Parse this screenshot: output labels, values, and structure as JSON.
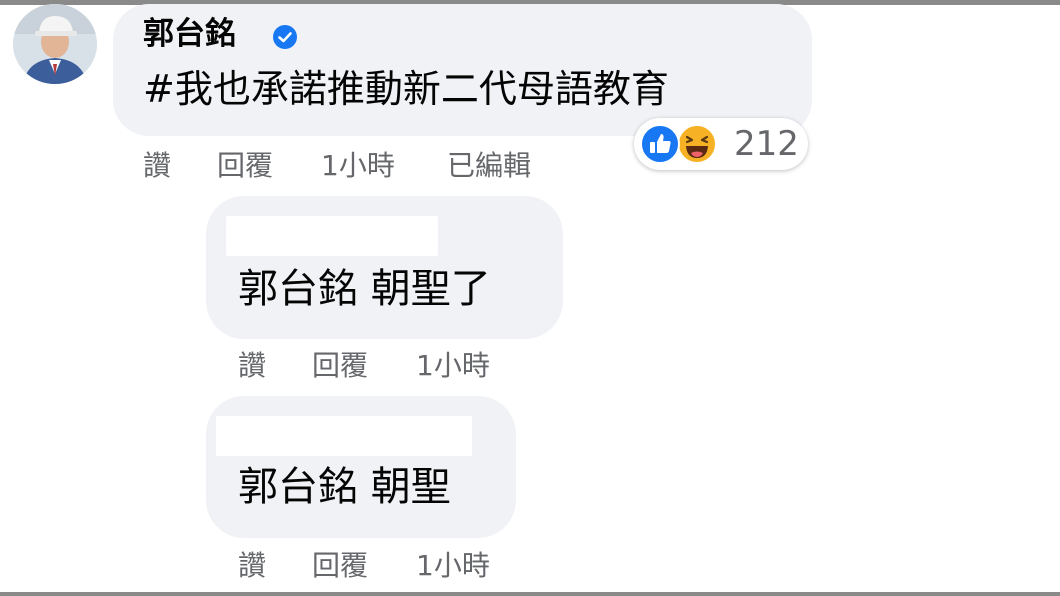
{
  "comment": {
    "author": "郭台銘",
    "text": "#我也承諾推動新二代母語教育",
    "actions": {
      "like": "讚",
      "reply": "回覆",
      "time": "1小時",
      "edited": "已編輯"
    },
    "reactions": {
      "icons": [
        "like-icon",
        "haha-icon"
      ],
      "count": "212"
    }
  },
  "replies": [
    {
      "text": "郭台銘 朝聖了",
      "actions": {
        "like": "讚",
        "reply": "回覆",
        "time": "1小時"
      }
    },
    {
      "text": "郭台銘 朝聖",
      "actions": {
        "like": "讚",
        "reply": "回覆",
        "time": "1小時"
      }
    }
  ],
  "colors": {
    "bubble": "#f0f2f5",
    "secondary_text": "#65676b",
    "verified": "#1877f2",
    "like": "#1877f2",
    "haha": "#f7b125"
  }
}
